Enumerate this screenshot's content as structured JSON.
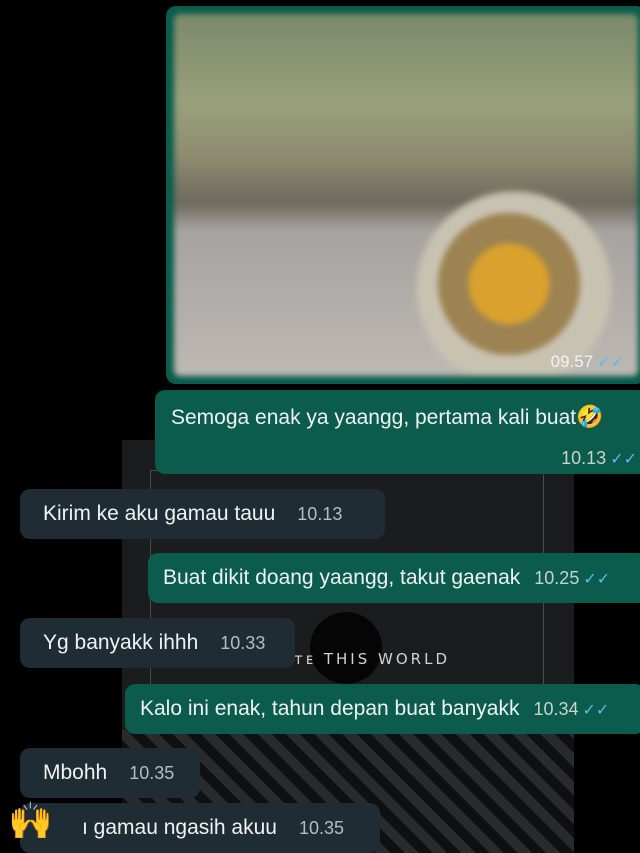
{
  "wallpaper": {
    "text": "ᴛᴇ THIS WORLD"
  },
  "photo_message": {
    "time": "09.57",
    "check": "✓✓"
  },
  "messages": [
    {
      "text": "Semoga enak ya yaangg, pertama kali buat",
      "time": "10.13",
      "check": "✓✓",
      "emoji": "🤣"
    },
    {
      "text": "Kirim ke aku gamau tauu",
      "time": "10.13"
    },
    {
      "text": "Buat dikit doang yaangg, takut gaenak",
      "time": "10.25",
      "check": "✓✓"
    },
    {
      "text": "Yg banyakk ihhh",
      "time": "10.33"
    },
    {
      "text": "Kalo ini enak, tahun depan buat banyakk",
      "time": "10.34",
      "check": "✓✓"
    },
    {
      "text": "Mbohh",
      "time": "10.35"
    },
    {
      "text": "ı gamau ngasih akuu",
      "time": "10.35"
    }
  ],
  "overlay_emoji": "🙌"
}
